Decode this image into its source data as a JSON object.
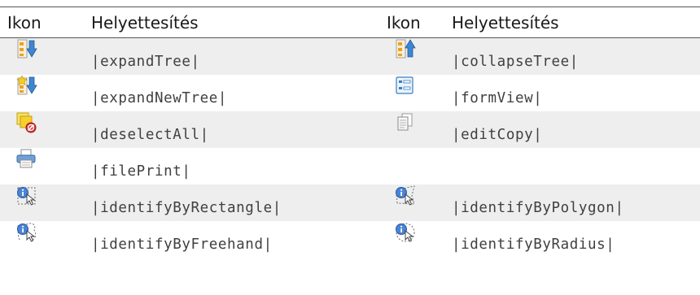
{
  "table": {
    "headers": [
      "Ikon",
      "Helyettesítés",
      "Ikon",
      "Helyettesítés"
    ],
    "rows": [
      {
        "left": {
          "icon": "expand-tree-icon",
          "text": "|expandTree|"
        },
        "right": {
          "icon": "collapse-tree-icon",
          "text": "|collapseTree|"
        }
      },
      {
        "left": {
          "icon": "expand-new-tree-icon",
          "text": "|expandNewTree|"
        },
        "right": {
          "icon": "form-view-icon",
          "text": "|formView|"
        }
      },
      {
        "left": {
          "icon": "deselect-all-icon",
          "text": "|deselectAll|"
        },
        "right": {
          "icon": "edit-copy-icon",
          "text": "|editCopy|"
        }
      },
      {
        "left": {
          "icon": "file-print-icon",
          "text": "|filePrint|"
        },
        "right": {
          "icon": "",
          "text": ""
        }
      },
      {
        "left": {
          "icon": "identify-by-rectangle-icon",
          "text": "|identifyByRectangle|"
        },
        "right": {
          "icon": "identify-by-polygon-icon",
          "text": "|identifyByPolygon|"
        }
      },
      {
        "left": {
          "icon": "identify-by-freehand-icon",
          "text": "|identifyByFreehand|"
        },
        "right": {
          "icon": "identify-by-radius-icon",
          "text": "|identifyByRadius|"
        }
      }
    ],
    "colors": {
      "row_stripe": "#eeeeee",
      "rule": "#555555",
      "arrow_blue": "#3f86d0",
      "tree_orange": "#f0a020",
      "info_blue": "#4a84d6",
      "cancel_red": "#d83030"
    }
  }
}
